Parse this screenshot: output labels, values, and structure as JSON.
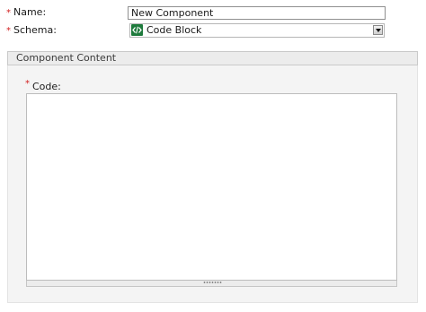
{
  "form": {
    "name_field": {
      "required_mark": "*",
      "label": "Name:",
      "value": "New Component"
    },
    "schema_field": {
      "required_mark": "*",
      "label": "Schema:",
      "selected_value": "Code Block",
      "selected_icon": "code-block-schema-icon"
    }
  },
  "section": {
    "title": "Component Content",
    "code_field": {
      "required_mark": "*",
      "label": "Code:",
      "value": ""
    }
  },
  "colors": {
    "required": "#d21f1f",
    "schema_icon": "#1e7a3c",
    "section_header_bg": "#ececec",
    "section_body_bg": "#f4f4f4"
  }
}
